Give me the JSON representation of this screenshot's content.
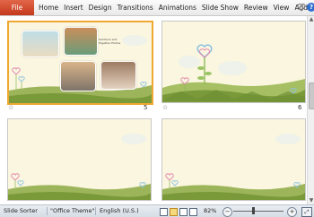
{
  "ribbon": {
    "file_label": "File",
    "tabs": [
      {
        "label": "Home"
      },
      {
        "label": "Insert"
      },
      {
        "label": "Design"
      },
      {
        "label": "Transitions"
      },
      {
        "label": "Animations"
      },
      {
        "label": "Slide Show"
      },
      {
        "label": "Review"
      },
      {
        "label": "View"
      },
      {
        "label": "Add-Ins"
      }
    ],
    "help_label": "?"
  },
  "slides": [
    {
      "number": "5",
      "selected": true,
      "caption": "Outdoors and Together Photos"
    },
    {
      "number": "6",
      "selected": false
    },
    {
      "number": "",
      "selected": false
    },
    {
      "number": "",
      "selected": false
    }
  ],
  "transition_icon": "☆",
  "status_bar": {
    "view_mode": "Slide Sorter",
    "theme": "\"Office Theme\"",
    "language": "English (U.S.)",
    "zoom": "82%",
    "zoom_minus": "−",
    "zoom_plus": "+"
  },
  "colors": {
    "file_tab": "#d24726",
    "selected_border": "#f0a830",
    "slide_background": "#faf6df",
    "hill_green": "#8aa542"
  }
}
